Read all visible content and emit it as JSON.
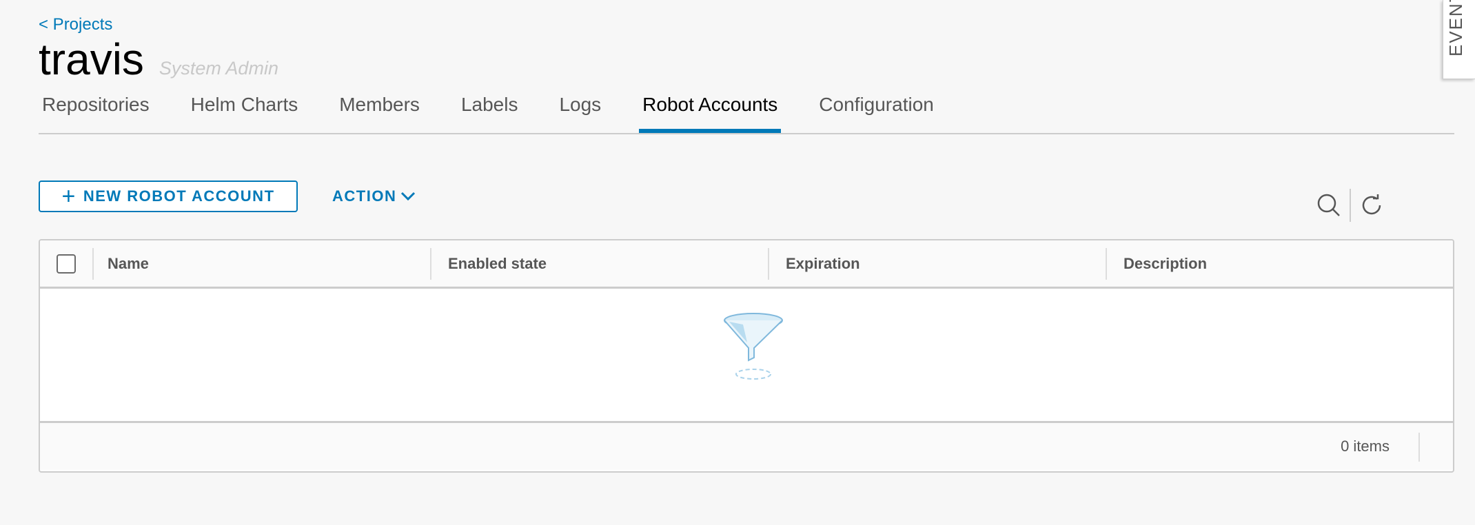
{
  "header": {
    "back_label": "< Projects",
    "project_name": "travis",
    "role": "System Admin"
  },
  "tabs": [
    {
      "label": "Repositories",
      "active": false
    },
    {
      "label": "Helm Charts",
      "active": false
    },
    {
      "label": "Members",
      "active": false
    },
    {
      "label": "Labels",
      "active": false
    },
    {
      "label": "Logs",
      "active": false
    },
    {
      "label": "Robot Accounts",
      "active": true
    },
    {
      "label": "Configuration",
      "active": false
    }
  ],
  "toolbar": {
    "new_robot_label": "NEW ROBOT ACCOUNT",
    "action_label": "ACTION",
    "search_icon": "search-icon",
    "refresh_icon": "refresh-icon"
  },
  "grid": {
    "columns": [
      "Name",
      "Enabled state",
      "Expiration",
      "Description"
    ],
    "rows": [],
    "empty_icon": "funnel-icon",
    "footer": {
      "count_label": "0 items"
    }
  },
  "side_panel": {
    "label": "EVENT"
  },
  "colors": {
    "accent": "#0079b8",
    "background": "#f7f7f7",
    "border": "#cccccc"
  }
}
